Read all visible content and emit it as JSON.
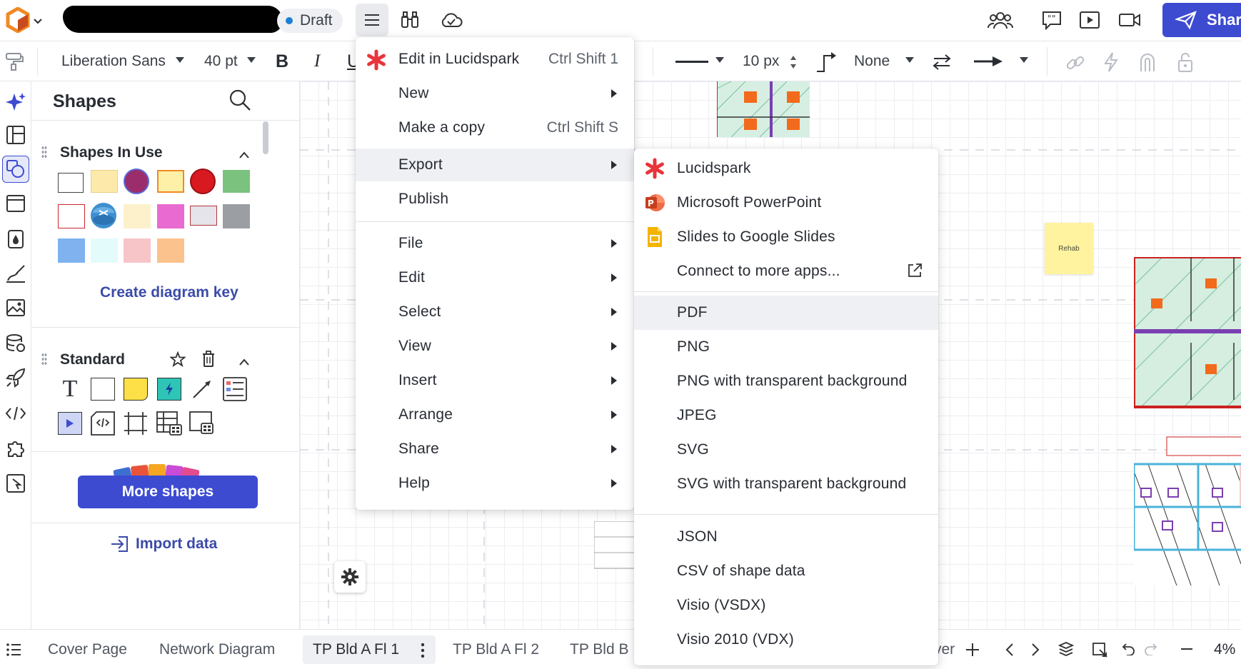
{
  "topbar": {
    "draft_label": "Draft",
    "share_label": "Shar"
  },
  "toolbar": {
    "font_family": "Liberation Sans",
    "font_size": "40 pt",
    "bold_label": "B",
    "italic_label": "I",
    "underline_label": "U",
    "line_width": "10 px",
    "line_start": "None"
  },
  "shapes_panel": {
    "title": "Shapes",
    "in_use_title": "Shapes In Use",
    "create_key_label": "Create diagram key",
    "standard_title": "Standard",
    "text_shape_label": "T",
    "more_shapes_label": "More shapes",
    "import_data_label": "Import data"
  },
  "canvas": {
    "rehab_note": "Rehab"
  },
  "main_menu": {
    "items": [
      {
        "label": "Edit in Lucidspark",
        "shortcut": "Ctrl Shift 1"
      },
      {
        "label": "New"
      },
      {
        "label": "Make a copy",
        "shortcut": "Ctrl Shift S"
      },
      {
        "label": "Export"
      },
      {
        "label": "Publish"
      },
      {
        "label": "File"
      },
      {
        "label": "Edit"
      },
      {
        "label": "Select"
      },
      {
        "label": "View"
      },
      {
        "label": "Insert"
      },
      {
        "label": "Arrange"
      },
      {
        "label": "Share"
      },
      {
        "label": "Help"
      }
    ]
  },
  "export_menu": {
    "apps": [
      {
        "label": "Lucidspark",
        "icon": "lucidspark-icon"
      },
      {
        "label": "Microsoft PowerPoint",
        "icon": "powerpoint-icon"
      },
      {
        "label": "Slides to Google Slides",
        "icon": "google-slides-icon"
      },
      {
        "label": "Connect to more apps...",
        "icon": "external-link-icon"
      }
    ],
    "formats_1": [
      "PDF",
      "PNG",
      "PNG with transparent background",
      "JPEG",
      "SVG",
      "SVG with transparent background"
    ],
    "formats_2": [
      "JSON",
      "CSV of shape data",
      "Visio (VSDX)",
      "Visio 2010 (VDX)"
    ]
  },
  "bottom_bar": {
    "tabs": [
      "Cover Page",
      "Network Diagram",
      "TP Bld A Fl 1",
      "TP Bld A Fl 2",
      "TP Bld B I"
    ],
    "overflow_text": "ver",
    "zoom": "4%"
  },
  "colors": {
    "accent": "#3d4bd1",
    "link": "#3b4ba8",
    "lucid_orange": "#f08a24",
    "draft_dot": "#1b7fd6"
  }
}
